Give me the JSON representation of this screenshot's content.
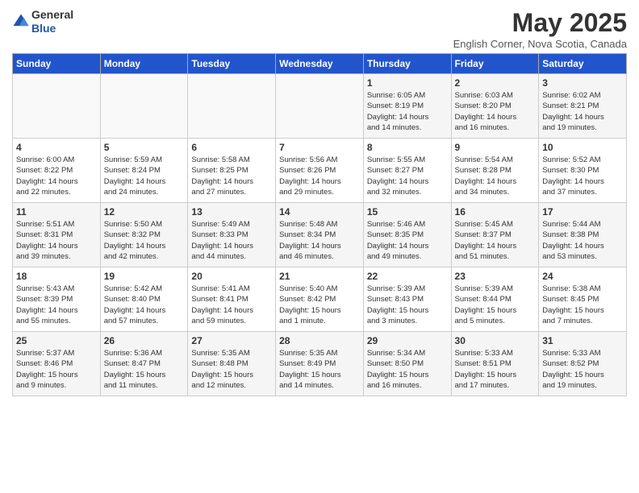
{
  "header": {
    "logo_general": "General",
    "logo_blue": "Blue",
    "month_title": "May 2025",
    "location": "English Corner, Nova Scotia, Canada"
  },
  "weekdays": [
    "Sunday",
    "Monday",
    "Tuesday",
    "Wednesday",
    "Thursday",
    "Friday",
    "Saturday"
  ],
  "weeks": [
    [
      {
        "day": "",
        "info": ""
      },
      {
        "day": "",
        "info": ""
      },
      {
        "day": "",
        "info": ""
      },
      {
        "day": "",
        "info": ""
      },
      {
        "day": "1",
        "info": "Sunrise: 6:05 AM\nSunset: 8:19 PM\nDaylight: 14 hours\nand 14 minutes."
      },
      {
        "day": "2",
        "info": "Sunrise: 6:03 AM\nSunset: 8:20 PM\nDaylight: 14 hours\nand 16 minutes."
      },
      {
        "day": "3",
        "info": "Sunrise: 6:02 AM\nSunset: 8:21 PM\nDaylight: 14 hours\nand 19 minutes."
      }
    ],
    [
      {
        "day": "4",
        "info": "Sunrise: 6:00 AM\nSunset: 8:22 PM\nDaylight: 14 hours\nand 22 minutes."
      },
      {
        "day": "5",
        "info": "Sunrise: 5:59 AM\nSunset: 8:24 PM\nDaylight: 14 hours\nand 24 minutes."
      },
      {
        "day": "6",
        "info": "Sunrise: 5:58 AM\nSunset: 8:25 PM\nDaylight: 14 hours\nand 27 minutes."
      },
      {
        "day": "7",
        "info": "Sunrise: 5:56 AM\nSunset: 8:26 PM\nDaylight: 14 hours\nand 29 minutes."
      },
      {
        "day": "8",
        "info": "Sunrise: 5:55 AM\nSunset: 8:27 PM\nDaylight: 14 hours\nand 32 minutes."
      },
      {
        "day": "9",
        "info": "Sunrise: 5:54 AM\nSunset: 8:28 PM\nDaylight: 14 hours\nand 34 minutes."
      },
      {
        "day": "10",
        "info": "Sunrise: 5:52 AM\nSunset: 8:30 PM\nDaylight: 14 hours\nand 37 minutes."
      }
    ],
    [
      {
        "day": "11",
        "info": "Sunrise: 5:51 AM\nSunset: 8:31 PM\nDaylight: 14 hours\nand 39 minutes."
      },
      {
        "day": "12",
        "info": "Sunrise: 5:50 AM\nSunset: 8:32 PM\nDaylight: 14 hours\nand 42 minutes."
      },
      {
        "day": "13",
        "info": "Sunrise: 5:49 AM\nSunset: 8:33 PM\nDaylight: 14 hours\nand 44 minutes."
      },
      {
        "day": "14",
        "info": "Sunrise: 5:48 AM\nSunset: 8:34 PM\nDaylight: 14 hours\nand 46 minutes."
      },
      {
        "day": "15",
        "info": "Sunrise: 5:46 AM\nSunset: 8:35 PM\nDaylight: 14 hours\nand 49 minutes."
      },
      {
        "day": "16",
        "info": "Sunrise: 5:45 AM\nSunset: 8:37 PM\nDaylight: 14 hours\nand 51 minutes."
      },
      {
        "day": "17",
        "info": "Sunrise: 5:44 AM\nSunset: 8:38 PM\nDaylight: 14 hours\nand 53 minutes."
      }
    ],
    [
      {
        "day": "18",
        "info": "Sunrise: 5:43 AM\nSunset: 8:39 PM\nDaylight: 14 hours\nand 55 minutes."
      },
      {
        "day": "19",
        "info": "Sunrise: 5:42 AM\nSunset: 8:40 PM\nDaylight: 14 hours\nand 57 minutes."
      },
      {
        "day": "20",
        "info": "Sunrise: 5:41 AM\nSunset: 8:41 PM\nDaylight: 14 hours\nand 59 minutes."
      },
      {
        "day": "21",
        "info": "Sunrise: 5:40 AM\nSunset: 8:42 PM\nDaylight: 15 hours\nand 1 minute."
      },
      {
        "day": "22",
        "info": "Sunrise: 5:39 AM\nSunset: 8:43 PM\nDaylight: 15 hours\nand 3 minutes."
      },
      {
        "day": "23",
        "info": "Sunrise: 5:39 AM\nSunset: 8:44 PM\nDaylight: 15 hours\nand 5 minutes."
      },
      {
        "day": "24",
        "info": "Sunrise: 5:38 AM\nSunset: 8:45 PM\nDaylight: 15 hours\nand 7 minutes."
      }
    ],
    [
      {
        "day": "25",
        "info": "Sunrise: 5:37 AM\nSunset: 8:46 PM\nDaylight: 15 hours\nand 9 minutes."
      },
      {
        "day": "26",
        "info": "Sunrise: 5:36 AM\nSunset: 8:47 PM\nDaylight: 15 hours\nand 11 minutes."
      },
      {
        "day": "27",
        "info": "Sunrise: 5:35 AM\nSunset: 8:48 PM\nDaylight: 15 hours\nand 12 minutes."
      },
      {
        "day": "28",
        "info": "Sunrise: 5:35 AM\nSunset: 8:49 PM\nDaylight: 15 hours\nand 14 minutes."
      },
      {
        "day": "29",
        "info": "Sunrise: 5:34 AM\nSunset: 8:50 PM\nDaylight: 15 hours\nand 16 minutes."
      },
      {
        "day": "30",
        "info": "Sunrise: 5:33 AM\nSunset: 8:51 PM\nDaylight: 15 hours\nand 17 minutes."
      },
      {
        "day": "31",
        "info": "Sunrise: 5:33 AM\nSunset: 8:52 PM\nDaylight: 15 hours\nand 19 minutes."
      }
    ]
  ]
}
